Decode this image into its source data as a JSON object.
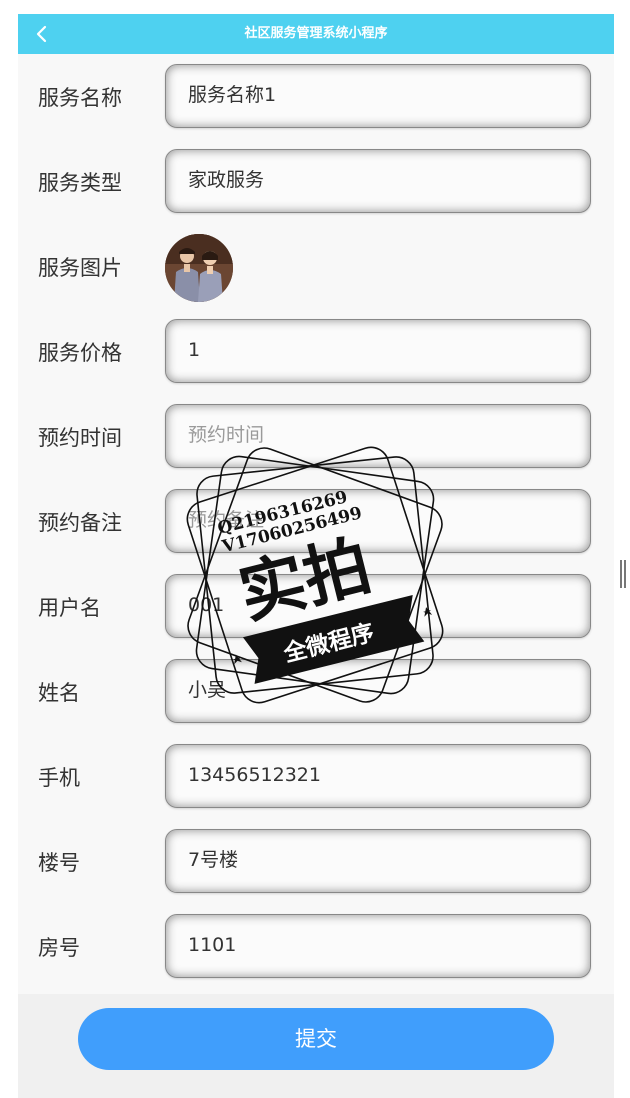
{
  "header": {
    "title": "社区服务管理系统小程序",
    "back_icon": "chevron-left-icon"
  },
  "form": {
    "rows": [
      {
        "label": "服务名称",
        "value": "服务名称1",
        "placeholder": ""
      },
      {
        "label": "服务类型",
        "value": "家政服务",
        "placeholder": ""
      },
      {
        "label": "服务图片",
        "value": "",
        "placeholder": ""
      },
      {
        "label": "服务价格",
        "value": "1",
        "placeholder": ""
      },
      {
        "label": "预约时间",
        "value": "",
        "placeholder": "预约时间"
      },
      {
        "label": "预约备注",
        "value": "",
        "placeholder": "预约备注"
      },
      {
        "label": "用户名",
        "value": "001",
        "placeholder": ""
      },
      {
        "label": "姓名",
        "value": "小吴",
        "placeholder": ""
      },
      {
        "label": "手机",
        "value": "13456512321",
        "placeholder": ""
      },
      {
        "label": "楼号",
        "value": "7号楼",
        "placeholder": ""
      },
      {
        "label": "房号",
        "value": "1101",
        "placeholder": ""
      }
    ]
  },
  "submit": {
    "label": "提交"
  },
  "watermark": {
    "line1": "Q2196316269",
    "line2": "V17060256499",
    "main": "实拍",
    "ribbon": "全微程序"
  },
  "colors": {
    "header_bg": "#4ed1f0",
    "submit_bg": "#409efc",
    "page_bg": "#f8f8f8"
  }
}
